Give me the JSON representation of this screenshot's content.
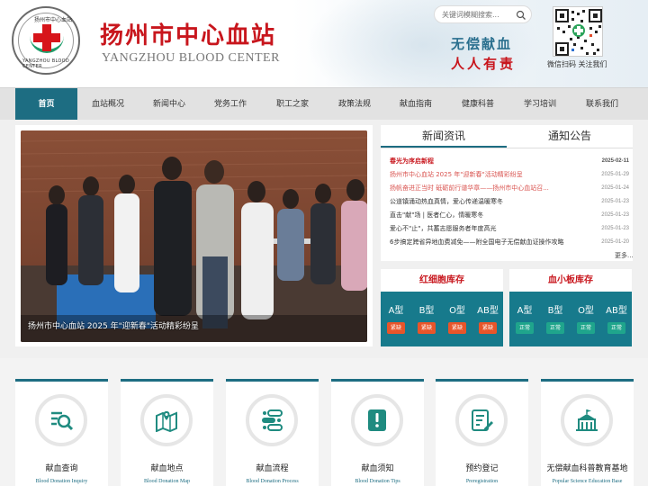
{
  "header": {
    "logo_top_text": "扬州市中心血站",
    "logo_bottom_text": "YANGZHOU BLOOD CENTER",
    "brand_cn": "扬州市中心血站",
    "brand_en": "YANGZHOU BLOOD CENTER",
    "search_placeholder": "关键词模糊搜索...",
    "slogan_line1": "无偿献血",
    "slogan_line2": "人人有责",
    "qr_caption": "微信扫码 关注我们"
  },
  "nav": {
    "items": [
      {
        "label": "首页",
        "active": true
      },
      {
        "label": "血站概况",
        "active": false
      },
      {
        "label": "新闻中心",
        "active": false
      },
      {
        "label": "党务工作",
        "active": false
      },
      {
        "label": "职工之家",
        "active": false
      },
      {
        "label": "政策法规",
        "active": false
      },
      {
        "label": "献血指南",
        "active": false
      },
      {
        "label": "健康科普",
        "active": false
      },
      {
        "label": "学习培训",
        "active": false
      },
      {
        "label": "联系我们",
        "active": false
      }
    ]
  },
  "banner": {
    "caption": "扬州市中心血站 2025 年\"迎新春\"活动精彩纷呈"
  },
  "news": {
    "tabs": [
      "新闻资讯",
      "通知公告"
    ],
    "items": [
      {
        "title": "春光为序启新程",
        "date": "2025-02-11",
        "color": "#c8161d",
        "bold": true
      },
      {
        "title": "扬州市中心血站 2025 年\"迎新春\"活动精彩纷呈",
        "date": "2025-01-29",
        "color": "#d9534f",
        "bold": false
      },
      {
        "title": "扬帆奋进正当时 砥砺前行谱华章——扬州市中心血站召...",
        "date": "2025-01-24",
        "color": "#d9534f",
        "bold": false
      },
      {
        "title": "公道镇涌动热血真情，爱心传递温暖寒冬",
        "date": "2025-01-23",
        "color": "#333333",
        "bold": false
      },
      {
        "title": "直击\"献\"场 | 医者仁心，情暖寒冬",
        "date": "2025-01-23",
        "color": "#333333",
        "bold": false
      },
      {
        "title": "爱心不\"止\"，共蓄志愿服务者年度高光",
        "date": "2025-01-23",
        "color": "#333333",
        "bold": false
      },
      {
        "title": "6步搞定跨省异地血费减免——附全国电子无偿献血证操作攻略",
        "date": "2025-01-20",
        "color": "#333333",
        "bold": false
      }
    ],
    "more_label": "更多..."
  },
  "stock": {
    "red_cell": {
      "title": "红细胞库存",
      "types": [
        "A型",
        "B型",
        "O型",
        "AB型"
      ],
      "status": [
        "紧缺",
        "紧缺",
        "紧缺",
        "紧缺"
      ],
      "status_color": "#e8552a"
    },
    "platelet": {
      "title": "血小板库存",
      "types": [
        "A型",
        "B型",
        "O型",
        "AB型"
      ],
      "status": [
        "正常",
        "正常",
        "正常",
        "正常"
      ],
      "status_color": "#1fa58c"
    }
  },
  "services": [
    {
      "title": "献血查询",
      "sub": "Blood Donation Inquiry",
      "icon": "search-list-icon"
    },
    {
      "title": "献血地点",
      "sub": "Blood Donation Map",
      "icon": "map-pin-icon"
    },
    {
      "title": "献血流程",
      "sub": "Blood Donation Process",
      "icon": "process-icon"
    },
    {
      "title": "献血须知",
      "sub": "Blood Donation Tips",
      "icon": "notice-icon"
    },
    {
      "title": "预约登记",
      "sub": "Preregistration",
      "icon": "form-edit-icon"
    },
    {
      "title": "无偿献血科普教育基地",
      "sub": "Popular Science Education Base",
      "icon": "building-icon"
    }
  ],
  "colors": {
    "brand_red": "#c8161d",
    "brand_teal": "#1d6d82",
    "stock_bg": "#177a8c"
  }
}
